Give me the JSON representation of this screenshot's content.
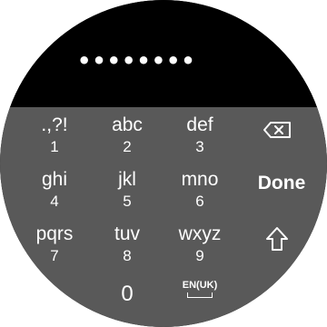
{
  "password": {
    "masked_value": "••••••••"
  },
  "keys": [
    {
      "letters": ".,?!",
      "digit": "1"
    },
    {
      "letters": "abc",
      "digit": "2"
    },
    {
      "letters": "def",
      "digit": "3"
    },
    {
      "letters": "ghi",
      "digit": "4"
    },
    {
      "letters": "jkl",
      "digit": "5"
    },
    {
      "letters": "mno",
      "digit": "6"
    },
    {
      "letters": "pqrs",
      "digit": "7"
    },
    {
      "letters": "tuv",
      "digit": "8"
    },
    {
      "letters": "wxyz",
      "digit": "9"
    }
  ],
  "zero": "0",
  "language": "EN(UK)",
  "done_label": "Done",
  "icons": {
    "backspace": "backspace-icon",
    "shift": "shift-icon",
    "space": "space-icon"
  },
  "colors": {
    "keyboard_bg": "#595959",
    "display_bg": "#000000",
    "text": "#ffffff"
  }
}
